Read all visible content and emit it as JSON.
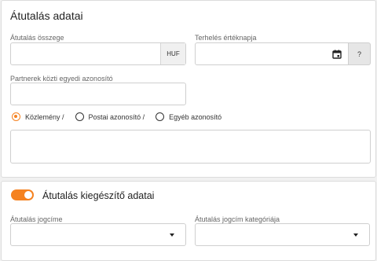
{
  "transfer": {
    "title": "Átutalás adatai",
    "amount_label": "Átutalás összege",
    "amount_value": "",
    "currency": "HUF",
    "value_date_label": "Terhelés értéknapja",
    "value_date_value": "",
    "help_label": "?",
    "partner_id_label": "Partnerek közti egyedi azonosító",
    "partner_id_value": "",
    "radio_options": [
      "Közlemény /",
      "Postai azonosító /",
      "Egyéb azonosító"
    ],
    "selected_option": "Közlemény /",
    "message_value": ""
  },
  "supplementary": {
    "toggle_on": true,
    "title": "Átutalás kiegészítő adatai",
    "title_label": "Átutalás jogcíme",
    "title_value": "",
    "category_label": "Átutalás jogcím kategóriája",
    "category_value": ""
  },
  "colors": {
    "accent": "#f58220",
    "card_bg": "#ffffff",
    "page_bg": "#f1f1f1"
  },
  "icons": {
    "calendar": "calendar-icon",
    "dropdown": "chevron-down-icon"
  }
}
